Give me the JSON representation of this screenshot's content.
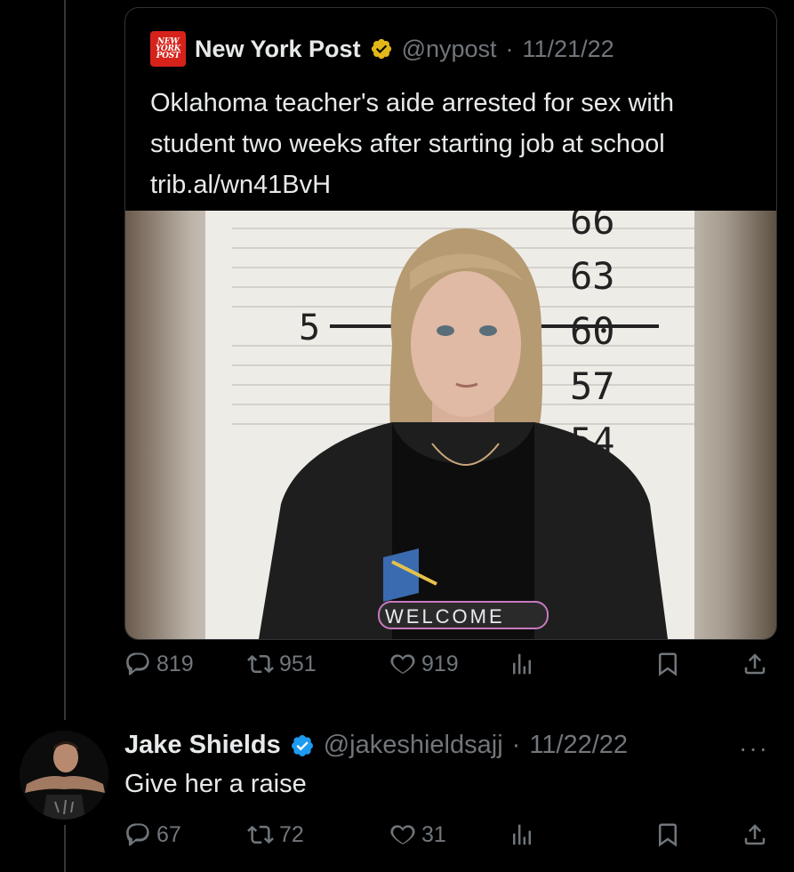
{
  "quoted_tweet": {
    "logo_text": [
      "NEW",
      "YORK",
      "POST"
    ],
    "display_name": "New York Post",
    "handle": "@nypost",
    "separator": "·",
    "date": "11/21/22",
    "text": "Oklahoma teacher's aide arrested for sex with student two weeks after starting job at school trib.al/wn41BvH",
    "photo": {
      "height_markers": [
        "66",
        "63",
        "60",
        "57",
        "54"
      ],
      "side_marker": "5",
      "shirt_text": "WELCOME"
    }
  },
  "quoted_actions": {
    "replies": "819",
    "retweets": "951",
    "likes": "919"
  },
  "reply": {
    "display_name": "Jake Shields",
    "handle": "@jakeshieldsajj",
    "separator": "·",
    "date": "11/22/22",
    "more": "···",
    "text": "Give her a raise"
  },
  "reply_actions": {
    "replies": "67",
    "retweets": "72",
    "likes": "31"
  },
  "colors": {
    "background": "#000000",
    "text": "#e7e9ea",
    "muted": "#71767b",
    "verified_blue": "#1d9bf0",
    "verified_gold": "#e2b719",
    "nypost_red": "#d6221b"
  },
  "icons": [
    "reply-icon",
    "retweet-icon",
    "like-icon",
    "views-icon",
    "bookmark-icon",
    "share-icon",
    "verified-badge-icon"
  ]
}
